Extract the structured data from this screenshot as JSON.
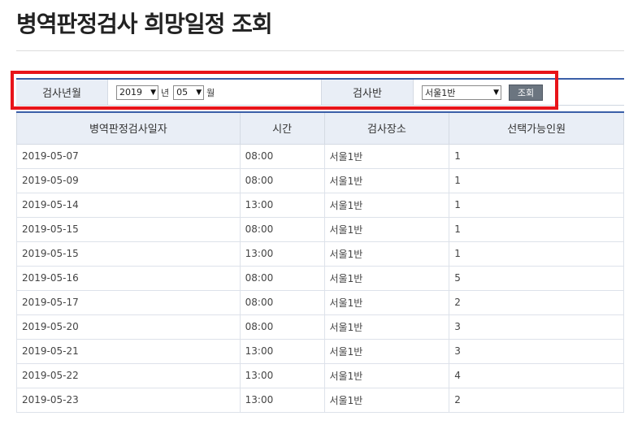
{
  "page": {
    "title": "병역판정검사 희망일정 조회"
  },
  "search": {
    "year_label": "검사년월",
    "year_value": "2019",
    "year_unit": "년",
    "month_value": "05",
    "month_unit": "월",
    "ban_label": "검사반",
    "ban_value": "서울1반",
    "search_button": "조회"
  },
  "table": {
    "headers": [
      "병역판정검사일자",
      "시간",
      "검사장소",
      "선택가능인원"
    ],
    "rows": [
      [
        "2019-05-07",
        "08:00",
        "서울1반",
        "1"
      ],
      [
        "2019-05-09",
        "08:00",
        "서울1반",
        "1"
      ],
      [
        "2019-05-14",
        "13:00",
        "서울1반",
        "1"
      ],
      [
        "2019-05-15",
        "08:00",
        "서울1반",
        "1"
      ],
      [
        "2019-05-15",
        "13:00",
        "서울1반",
        "1"
      ],
      [
        "2019-05-16",
        "08:00",
        "서울1반",
        "5"
      ],
      [
        "2019-05-17",
        "08:00",
        "서울1반",
        "2"
      ],
      [
        "2019-05-20",
        "08:00",
        "서울1반",
        "3"
      ],
      [
        "2019-05-21",
        "13:00",
        "서울1반",
        "3"
      ],
      [
        "2019-05-22",
        "13:00",
        "서울1반",
        "4"
      ],
      [
        "2019-05-23",
        "13:00",
        "서울1반",
        "2"
      ]
    ]
  },
  "colors": {
    "accent": "#3a5fa8",
    "highlight": "#e8141a",
    "header_bg": "#e9eef6",
    "button_bg": "#6b7580"
  }
}
